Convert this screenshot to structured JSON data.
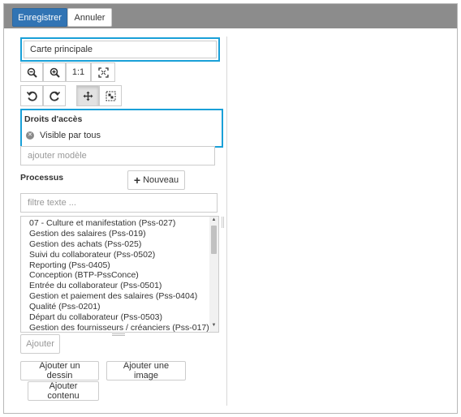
{
  "toolbar": {
    "save_label": "Enregistrer",
    "cancel_label": "Annuler"
  },
  "map": {
    "name_value": "Carte principale"
  },
  "zoom_tools": {
    "reset_label": "1:1"
  },
  "access": {
    "title": "Droits d'accès",
    "tags": [
      "Visible par tous"
    ],
    "add_model_placeholder": "ajouter modèle"
  },
  "processes": {
    "title": "Processus",
    "new_button_label": "Nouveau",
    "filter_placeholder": "filtre texte ...",
    "items": [
      "07 - Culture et manifestation (Pss-027)",
      "Gestion des salaires (Pss-019)",
      "Gestion des achats (Pss-025)",
      "Suivi du collaborateur (Pss-0502)",
      "Reporting (Pss-0405)",
      "Conception (BTP-PssConce)",
      "Entrée du collaborateur (Pss-0501)",
      "Gestion et paiement des salaires (Pss-0404)",
      "Qualité (Pss-0201)",
      "Départ du collaborateur (Pss-0503)",
      "Gestion des fournisseurs / créanciers (Pss-017)"
    ],
    "add_label": "Ajouter"
  },
  "actions": {
    "add_drawing_label": "Ajouter un dessin",
    "add_image_label": "Ajouter une image",
    "add_content_label": "Ajouter contenu"
  },
  "colors": {
    "primary": "#3174b4",
    "highlight_border": "#1aa0d8",
    "topbar": "#8c8c8c"
  }
}
